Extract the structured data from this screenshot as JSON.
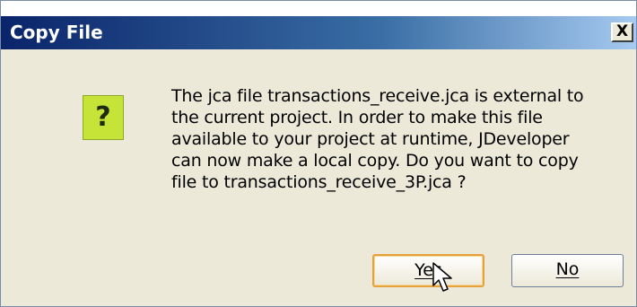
{
  "dialog": {
    "title": "Copy File",
    "close_label": "X",
    "icon": "question-icon",
    "icon_glyph": "?",
    "message_lines": [
      "The jca file transactions_receive.jca is external to",
      "the current project. In order to make this file",
      "available to your project at runtime, JDeveloper",
      "can now make a local copy. Do you want to copy",
      "file to transactions_receive_3P.jca ?"
    ],
    "buttons": {
      "yes": "Yes",
      "no": "No"
    }
  },
  "colors": {
    "titlebar_start": "#0a246a",
    "titlebar_end": "#a6caf0",
    "dialog_bg": "#ece9d8",
    "icon_bg": "#c6e337",
    "default_button_border": "#e5a23a"
  }
}
